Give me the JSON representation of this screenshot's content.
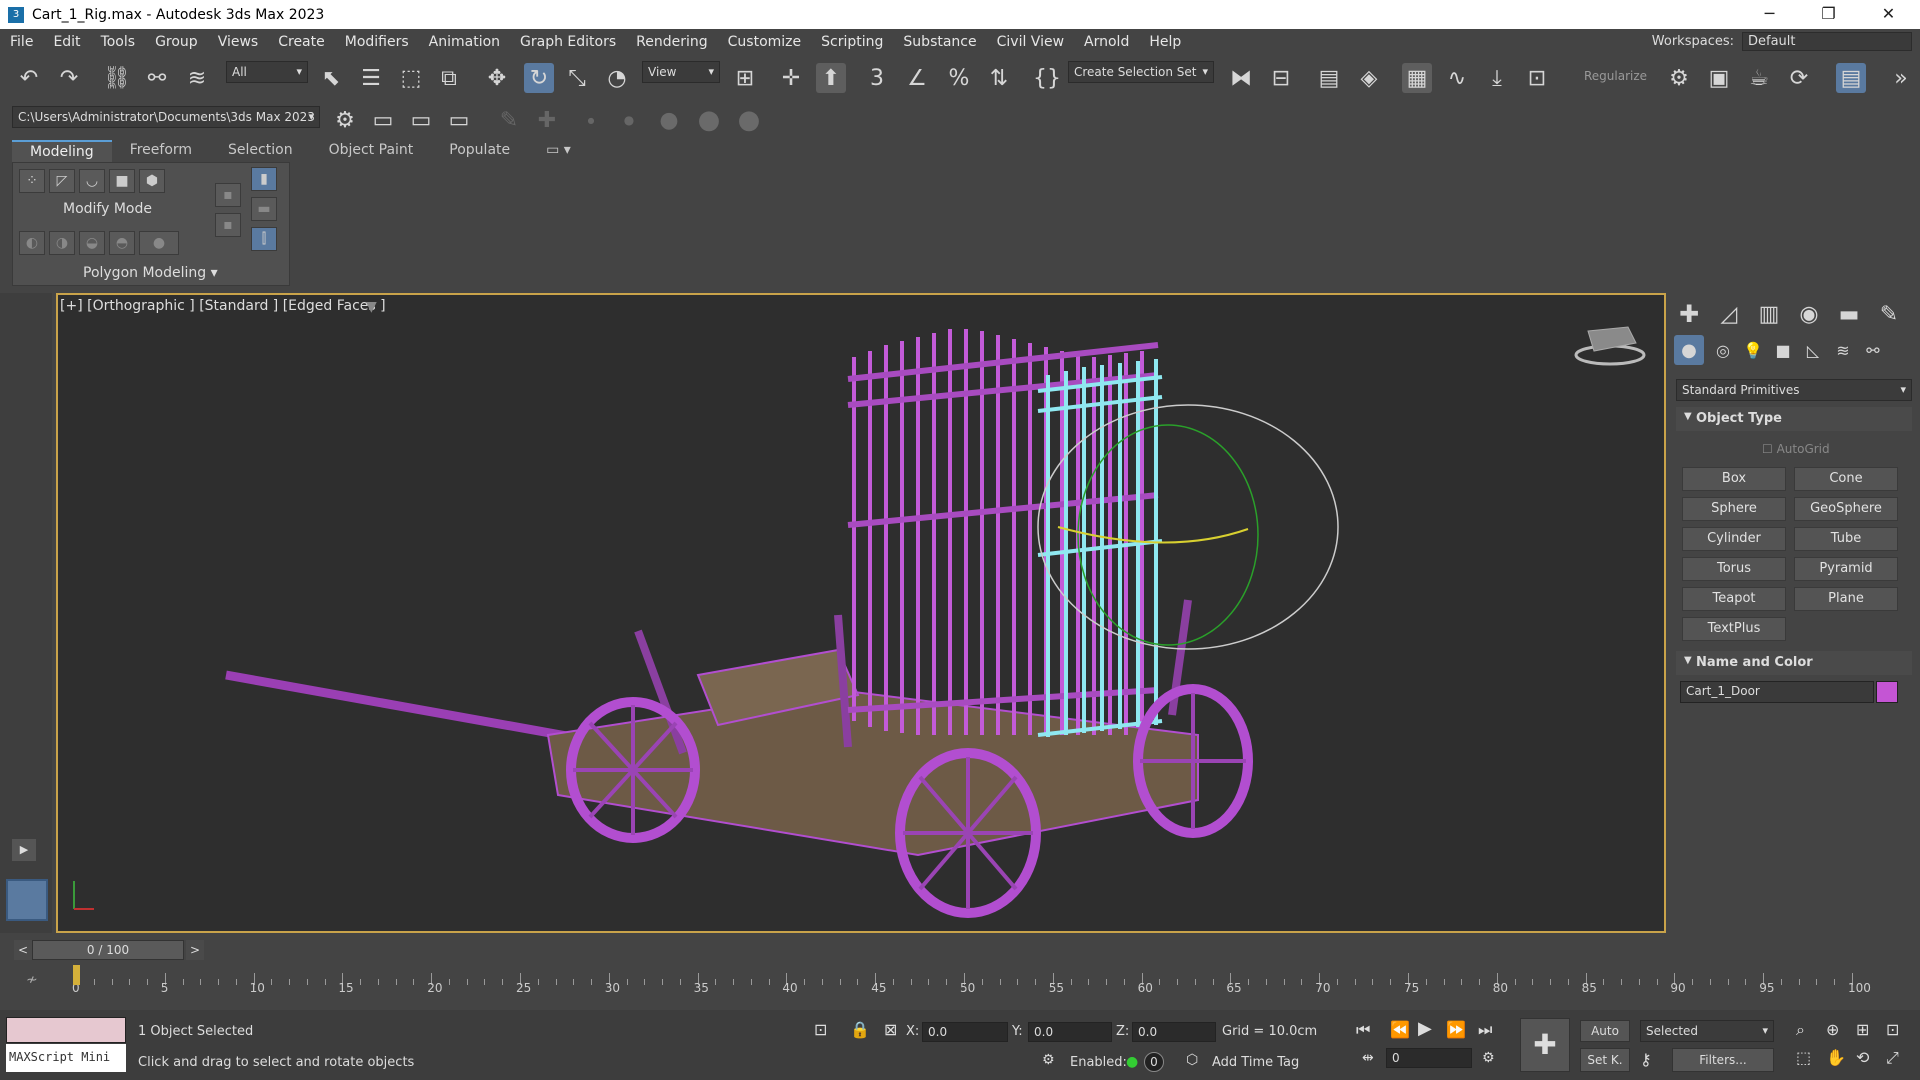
{
  "window": {
    "title": "Cart_1_Rig.max - Autodesk 3ds Max 2023",
    "minimize": "─",
    "maximize": "❐",
    "close": "✕"
  },
  "menu": {
    "items": [
      "File",
      "Edit",
      "Tools",
      "Group",
      "Views",
      "Create",
      "Modifiers",
      "Animation",
      "Graph Editors",
      "Rendering",
      "Customize",
      "Scripting",
      "Substance",
      "Civil View",
      "Arnold",
      "Help"
    ],
    "workspaces_label": "Workspaces:",
    "workspaces_value": "Default"
  },
  "toolbar": {
    "selection_filter": "All",
    "ref_coord": "View",
    "create_selection_set": "Create Selection Set",
    "regularize": "Regularize",
    "project_path": "C:\\Users\\Administrator\\Documents\\3ds Max 2023"
  },
  "ribbon": {
    "tabs": [
      "Modeling",
      "Freeform",
      "Selection",
      "Object Paint",
      "Populate"
    ],
    "mode_label": "Modify Mode",
    "panel_label": "Polygon Modeling"
  },
  "viewport": {
    "label": "[+] [Orthographic ] [Standard ] [Edged Faces ]"
  },
  "command_panel": {
    "category": "Standard Primitives",
    "object_type_title": "Object Type",
    "autogrid": "AutoGrid",
    "buttons": [
      "Box",
      "Cone",
      "Sphere",
      "GeoSphere",
      "Cylinder",
      "Tube",
      "Torus",
      "Pyramid",
      "Teapot",
      "Plane",
      "TextPlus"
    ],
    "name_color_title": "Name and Color",
    "object_name": "Cart_1_Door",
    "object_color": "#c455d4"
  },
  "timeline": {
    "frame": "0 / 100",
    "ticks": [
      "0",
      "5",
      "10",
      "15",
      "20",
      "25",
      "30",
      "35",
      "40",
      "45",
      "50",
      "55",
      "60",
      "65",
      "70",
      "75",
      "80",
      "85",
      "90",
      "95",
      "100"
    ]
  },
  "status": {
    "maxscript": "MAXScript Mini",
    "selected_count": "1 Object Selected",
    "prompt": "Click and drag to select and rotate objects",
    "x": "0.0",
    "y": "0.0",
    "z": "0.0",
    "x_label": "X:",
    "y_label": "Y:",
    "z_label": "Z:",
    "grid": "Grid = 10.0cm",
    "enabled_label": "Enabled:",
    "enabled_value": "0",
    "add_time_tag": "Add Time Tag",
    "auto": "Auto",
    "setk": "Set K.",
    "selected_dd": "Selected",
    "filters": "Filters...",
    "frame_field": "0"
  },
  "colors": {
    "accent": "#5b9ed6",
    "viewport_border": "#c9a34a",
    "selection": "#c455d4",
    "selected_object": "#8fe8f0"
  }
}
